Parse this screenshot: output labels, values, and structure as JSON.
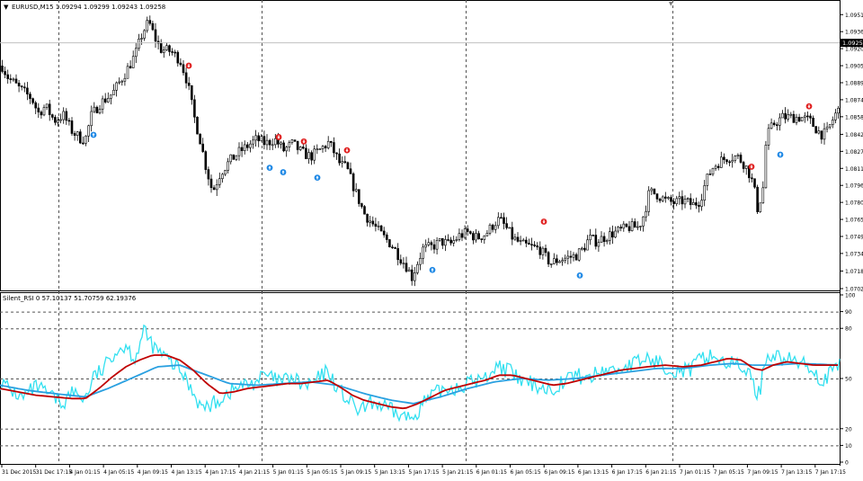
{
  "main": {
    "title": "EURUSD,M15  1.09294 1.09299 1.09243 1.09258",
    "current_price": "1.09258",
    "price_labels": [
      "1.09515",
      "1.09360",
      "1.09205",
      "1.09050",
      "1.08895",
      "1.08740",
      "1.08585",
      "1.08425",
      "1.08270",
      "1.08115",
      "1.07960",
      "1.07805",
      "1.07650",
      "1.07495",
      "1.07340",
      "1.07180",
      "1.07020"
    ]
  },
  "indicator": {
    "title": "Silent_RSI 0 57.10137 51.70759 62.19376",
    "levels": [
      "100",
      "90",
      "80",
      "50",
      "20",
      "10",
      "0"
    ]
  },
  "time_labels": [
    "31 Dec 2015",
    "31 Dec 17:15",
    "4 Jan 01:15",
    "4 Jan 05:15",
    "4 Jan 09:15",
    "4 Jan 13:15",
    "4 Jan 17:15",
    "4 Jan 21:15",
    "5 Jan 01:15",
    "5 Jan 05:15",
    "5 Jan 09:15",
    "5 Jan 13:15",
    "5 Jan 17:15",
    "5 Jan 21:15",
    "6 Jan 01:15",
    "6 Jan 05:15",
    "6 Jan 09:15",
    "6 Jan 13:15",
    "6 Jan 17:15",
    "6 Jan 21:15",
    "7 Jan 01:15",
    "7 Jan 05:15",
    "7 Jan 09:15",
    "7 Jan 13:15",
    "7 Jan 17:15"
  ],
  "colors": {
    "candle": "#000000",
    "arrow_up": "#1e88e5",
    "arrow_down": "#e02020",
    "rsi": "#33e0f0",
    "signal_red": "#c00000",
    "signal_blue": "#2aa0e0"
  },
  "chart_data": {
    "type": "candlestick",
    "symbol": "EURUSD",
    "timeframe": "M15",
    "ylim": [
      1.0702,
      1.0955
    ],
    "close_path": [
      [
        0,
        1.0908
      ],
      [
        8,
        1.0895
      ],
      [
        20,
        1.0885
      ],
      [
        35,
        1.0875
      ],
      [
        42,
        1.0862
      ],
      [
        50,
        1.0868
      ],
      [
        60,
        1.0855
      ],
      [
        70,
        1.086
      ],
      [
        80,
        1.0845
      ],
      [
        90,
        1.0838
      ],
      [
        96,
        1.084
      ],
      [
        100,
        1.0858
      ],
      [
        110,
        1.087
      ],
      [
        125,
        1.088
      ],
      [
        140,
        1.09
      ],
      [
        150,
        1.0915
      ],
      [
        158,
        1.0935
      ],
      [
        165,
        1.0945
      ],
      [
        172,
        1.093
      ],
      [
        178,
        1.092
      ],
      [
        190,
        1.0918
      ],
      [
        200,
        1.091
      ],
      [
        208,
        1.089
      ],
      [
        215,
        1.086
      ],
      [
        222,
        1.0838
      ],
      [
        228,
        1.0815
      ],
      [
        236,
        1.079
      ],
      [
        245,
        1.0808
      ],
      [
        255,
        1.0818
      ],
      [
        265,
        1.0826
      ],
      [
        275,
        1.0832
      ],
      [
        285,
        1.0838
      ],
      [
        295,
        1.0834
      ],
      [
        305,
        1.0838
      ],
      [
        315,
        1.0828
      ],
      [
        325,
        1.0834
      ],
      [
        335,
        1.0826
      ],
      [
        345,
        1.0822
      ],
      [
        355,
        1.0828
      ],
      [
        365,
        1.0835
      ],
      [
        372,
        1.0825
      ],
      [
        378,
        1.0815
      ],
      [
        385,
        1.0812
      ],
      [
        395,
        1.079
      ],
      [
        405,
        1.077
      ],
      [
        415,
        1.076
      ],
      [
        425,
        1.075
      ],
      [
        435,
        1.0742
      ],
      [
        445,
        1.073
      ],
      [
        452,
        1.0722
      ],
      [
        458,
        1.0712
      ],
      [
        462,
        1.0722
      ],
      [
        470,
        1.0738
      ],
      [
        480,
        1.074
      ],
      [
        490,
        1.0745
      ],
      [
        500,
        1.0742
      ],
      [
        510,
        1.075
      ],
      [
        520,
        1.0753
      ],
      [
        530,
        1.0748
      ],
      [
        540,
        1.0752
      ],
      [
        550,
        1.0762
      ],
      [
        555,
        1.0765
      ],
      [
        562,
        1.0758
      ],
      [
        570,
        1.0748
      ],
      [
        580,
        1.0742
      ],
      [
        590,
        1.074
      ],
      [
        600,
        1.0738
      ],
      [
        605,
        1.0732
      ],
      [
        612,
        1.0725
      ],
      [
        620,
        1.0728
      ],
      [
        630,
        1.073
      ],
      [
        640,
        1.0732
      ],
      [
        648,
        1.0738
      ],
      [
        655,
        1.0748
      ],
      [
        662,
        1.0745
      ],
      [
        670,
        1.0748
      ],
      [
        680,
        1.0752
      ],
      [
        690,
        1.0755
      ],
      [
        700,
        1.0758
      ],
      [
        710,
        1.0758
      ],
      [
        716,
        1.077
      ],
      [
        722,
        1.079
      ],
      [
        730,
        1.0788
      ],
      [
        740,
        1.0782
      ],
      [
        750,
        1.078
      ],
      [
        760,
        1.0782
      ],
      [
        770,
        1.0778
      ],
      [
        778,
        1.0782
      ],
      [
        785,
        1.08
      ],
      [
        792,
        1.0812
      ],
      [
        800,
        1.0818
      ],
      [
        810,
        1.0822
      ],
      [
        820,
        1.0822
      ],
      [
        828,
        1.0815
      ],
      [
        834,
        1.0805
      ],
      [
        838,
        1.0795
      ],
      [
        842,
        1.0775
      ],
      [
        848,
        1.079
      ],
      [
        852,
        1.084
      ],
      [
        860,
        1.0852
      ],
      [
        870,
        1.0858
      ],
      [
        880,
        1.0858
      ],
      [
        890,
        1.0858
      ],
      [
        900,
        1.0855
      ],
      [
        905,
        1.085
      ],
      [
        910,
        1.0845
      ],
      [
        915,
        1.0842
      ],
      [
        920,
        1.0845
      ],
      [
        928,
        1.086
      ],
      [
        936,
        1.0868
      ]
    ],
    "arrows_up": [
      [
        104,
        1.0842
      ],
      [
        300,
        1.0812
      ],
      [
        315,
        1.0808
      ],
      [
        353,
        1.0803
      ],
      [
        481,
        1.0719
      ],
      [
        645,
        1.0714
      ],
      [
        868,
        1.0824
      ]
    ],
    "arrows_down": [
      [
        210,
        1.0905
      ],
      [
        310,
        1.084
      ],
      [
        338,
        1.0836
      ],
      [
        386,
        1.0828
      ],
      [
        605,
        1.0763
      ],
      [
        836,
        1.0813
      ],
      [
        900,
        1.0868
      ]
    ],
    "rsi": {
      "ylim": [
        0,
        100
      ],
      "levels": [
        90,
        80,
        50,
        20,
        10
      ],
      "series_rsi": [
        [
          0,
          48
        ],
        [
          12,
          43
        ],
        [
          25,
          38
        ],
        [
          40,
          45
        ],
        [
          55,
          40
        ],
        [
          70,
          35
        ],
        [
          80,
          42
        ],
        [
          95,
          38
        ],
        [
          105,
          52
        ],
        [
          115,
          55
        ],
        [
          125,
          65
        ],
        [
          140,
          70
        ],
        [
          150,
          62
        ],
        [
          160,
          78
        ],
        [
          172,
          68
        ],
        [
          185,
          62
        ],
        [
          200,
          55
        ],
        [
          212,
          45
        ],
        [
          225,
          32
        ],
        [
          238,
          35
        ],
        [
          250,
          40
        ],
        [
          265,
          45
        ],
        [
          280,
          47
        ],
        [
          295,
          52
        ],
        [
          310,
          48
        ],
        [
          325,
          50
        ],
        [
          340,
          45
        ],
        [
          355,
          50
        ],
        [
          365,
          55
        ],
        [
          372,
          47
        ],
        [
          385,
          38
        ],
        [
          400,
          30
        ],
        [
          415,
          36
        ],
        [
          430,
          32
        ],
        [
          445,
          28
        ],
        [
          458,
          26
        ],
        [
          470,
          35
        ],
        [
          482,
          40
        ],
        [
          495,
          44
        ],
        [
          510,
          45
        ],
        [
          525,
          48
        ],
        [
          540,
          50
        ],
        [
          552,
          58
        ],
        [
          565,
          55
        ],
        [
          580,
          48
        ],
        [
          598,
          46
        ],
        [
          612,
          43
        ],
        [
          625,
          48
        ],
        [
          640,
          52
        ],
        [
          655,
          50
        ],
        [
          670,
          55
        ],
        [
          685,
          55
        ],
        [
          700,
          58
        ],
        [
          712,
          60
        ],
        [
          720,
          62
        ],
        [
          738,
          58
        ],
        [
          752,
          55
        ],
        [
          768,
          55
        ],
        [
          780,
          62
        ],
        [
          792,
          64
        ],
        [
          805,
          60
        ],
        [
          818,
          58
        ],
        [
          830,
          56
        ],
        [
          838,
          46
        ],
        [
          845,
          40
        ],
        [
          850,
          60
        ],
        [
          856,
          65
        ],
        [
          870,
          62
        ],
        [
          885,
          60
        ],
        [
          900,
          58
        ],
        [
          915,
          48
        ],
        [
          928,
          55
        ],
        [
          936,
          58
        ]
      ],
      "series_signal_red": [
        [
          0,
          44
        ],
        [
          20,
          42
        ],
        [
          40,
          40
        ],
        [
          60,
          39
        ],
        [
          80,
          38
        ],
        [
          95,
          38
        ],
        [
          110,
          44
        ],
        [
          125,
          51
        ],
        [
          140,
          57
        ],
        [
          155,
          61
        ],
        [
          170,
          64
        ],
        [
          185,
          64
        ],
        [
          200,
          61
        ],
        [
          215,
          55
        ],
        [
          230,
          47
        ],
        [
          245,
          41
        ],
        [
          260,
          42
        ],
        [
          275,
          44
        ],
        [
          290,
          45
        ],
        [
          305,
          46
        ],
        [
          320,
          47
        ],
        [
          335,
          47
        ],
        [
          350,
          48
        ],
        [
          365,
          49
        ],
        [
          378,
          45
        ],
        [
          392,
          40
        ],
        [
          405,
          37
        ],
        [
          420,
          35
        ],
        [
          435,
          33
        ],
        [
          450,
          32
        ],
        [
          465,
          35
        ],
        [
          480,
          39
        ],
        [
          495,
          43
        ],
        [
          510,
          45
        ],
        [
          525,
          47
        ],
        [
          540,
          49
        ],
        [
          555,
          52
        ],
        [
          570,
          52
        ],
        [
          585,
          50
        ],
        [
          600,
          48
        ],
        [
          615,
          46
        ],
        [
          630,
          47
        ],
        [
          645,
          49
        ],
        [
          660,
          51
        ],
        [
          675,
          53
        ],
        [
          690,
          55
        ],
        [
          705,
          56
        ],
        [
          720,
          57
        ],
        [
          740,
          58
        ],
        [
          760,
          57
        ],
        [
          780,
          58
        ],
        [
          795,
          60
        ],
        [
          810,
          62
        ],
        [
          825,
          61
        ],
        [
          838,
          56
        ],
        [
          848,
          55
        ],
        [
          860,
          58
        ],
        [
          875,
          60
        ],
        [
          890,
          59
        ],
        [
          905,
          58
        ],
        [
          920,
          58
        ],
        [
          936,
          58
        ]
      ],
      "series_signal_blue": [
        [
          0,
          46
        ],
        [
          30,
          43
        ],
        [
          60,
          41
        ],
        [
          95,
          39
        ],
        [
          120,
          44
        ],
        [
          150,
          51
        ],
        [
          175,
          57
        ],
        [
          200,
          58
        ],
        [
          225,
          53
        ],
        [
          255,
          47
        ],
        [
          285,
          46
        ],
        [
          315,
          47
        ],
        [
          345,
          48
        ],
        [
          375,
          46
        ],
        [
          405,
          41
        ],
        [
          435,
          37
        ],
        [
          460,
          35
        ],
        [
          490,
          39
        ],
        [
          520,
          44
        ],
        [
          550,
          48
        ],
        [
          580,
          50
        ],
        [
          610,
          49
        ],
        [
          640,
          50
        ],
        [
          670,
          52
        ],
        [
          700,
          54
        ],
        [
          730,
          56
        ],
        [
          760,
          56
        ],
        [
          790,
          58
        ],
        [
          815,
          59
        ],
        [
          838,
          58
        ],
        [
          860,
          58
        ],
        [
          890,
          59
        ],
        [
          936,
          58
        ]
      ]
    }
  }
}
